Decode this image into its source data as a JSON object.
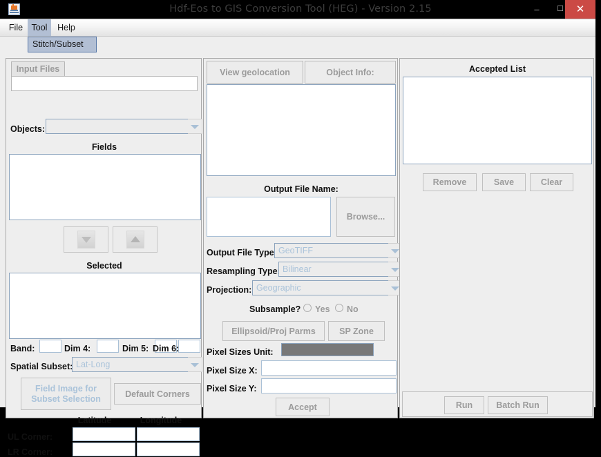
{
  "window": {
    "title": "Hdf-Eos to GIS Conversion Tool (HEG) - Version 2.15",
    "app_icon": "java-coffee-cup-icon",
    "minimize_label": "–",
    "maximize_label": "☐",
    "close_label": "✕"
  },
  "menubar": {
    "items": [
      {
        "label": "File"
      },
      {
        "label": "Tool"
      },
      {
        "label": "Help"
      }
    ],
    "open_menu": "Tool",
    "popup_items": [
      {
        "label": "Stitch/Subset"
      }
    ]
  },
  "left_panel": {
    "tab_label": "Input Files",
    "objects_label": "Objects:",
    "objects_value": "",
    "fields_header": "Fields",
    "fields_items": [],
    "move_down_icon": "arrow-down-icon",
    "move_up_icon": "arrow-up-icon",
    "selected_header": "Selected",
    "selected_items": [],
    "band_label": "Band:",
    "band_value": "",
    "dim4_label": "Dim 4:",
    "dim4_value": "",
    "dim5_label": "Dim 5:",
    "dim5_value": "",
    "dim6_label": "Dim 6:",
    "dim6_value": "",
    "spatial_subset_label": "Spatial Subset:",
    "spatial_subset_value": "Lat-Long",
    "field_image_button_line1": "Field Image for",
    "field_image_button_line2": "Subset Selection",
    "default_corners_button": "Default Corners",
    "latitude_header": "Latitude",
    "longitude_header": "Longitude",
    "ul_corner_label": "UL Corner:",
    "ul_corner_lat": "",
    "ul_corner_lon": "",
    "lr_corner_label": "LR Corner:",
    "lr_corner_lat": "",
    "lr_corner_lon": ""
  },
  "center_panel": {
    "view_geolocation_tab": "View geolocation",
    "object_info_tab": "Object Info:",
    "info_content": "",
    "output_file_name_label": "Output File Name:",
    "output_file_name_value": "",
    "browse_button": "Browse...",
    "output_file_type_label": "Output File Type:",
    "output_file_type_value": "GeoTIFF",
    "resampling_type_label": "Resampling Type:",
    "resampling_type_value": "Bilinear",
    "projection_label": "Projection:",
    "projection_value": "Geographic",
    "subsample_label": "Subsample?",
    "subsample_yes_label": "Yes",
    "subsample_no_label": "No",
    "subsample_selected": "",
    "ellipsoid_button": "Ellipsoid/Proj Parms",
    "sp_zone_button": "SP Zone",
    "pixel_sizes_unit_label": "Pixel Sizes Unit:",
    "pixel_sizes_unit_value": "",
    "pixel_size_x_label": "Pixel Size X:",
    "pixel_size_x_value": "",
    "pixel_size_y_label": "Pixel Size Y:",
    "pixel_size_y_value": "",
    "accept_button": "Accept"
  },
  "right_panel": {
    "accepted_list_header": "Accepted List",
    "accepted_items": [],
    "remove_button": "Remove",
    "save_button": "Save",
    "clear_button": "Clear",
    "run_button": "Run",
    "batch_run_button": "Batch Run"
  },
  "colors": {
    "menu_highlight": "#b2bfd4",
    "close_button": "#cb4a45",
    "disabled_field": "#787878",
    "placeholder_text": "#aac3da",
    "panel_bg": "#eeeeee"
  }
}
